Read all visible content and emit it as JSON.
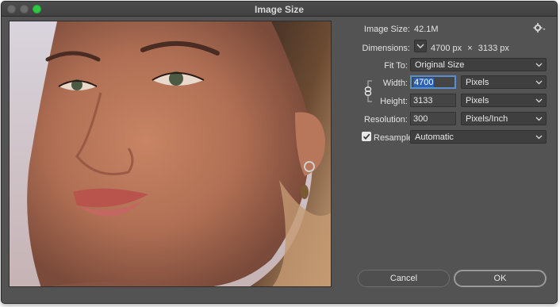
{
  "window": {
    "title": "Image Size"
  },
  "info": {
    "image_size_label": "Image Size:",
    "image_size_value": "42.1M",
    "dimensions_label": "Dimensions:",
    "dimensions_width": "4700 px",
    "dimensions_sep": "×",
    "dimensions_height": "3133 px"
  },
  "fit_to": {
    "label": "Fit To:",
    "value": "Original Size"
  },
  "width": {
    "label": "Width:",
    "value": "4700",
    "unit": "Pixels"
  },
  "height": {
    "label": "Height:",
    "value": "3133",
    "unit": "Pixels"
  },
  "resolution": {
    "label": "Resolution:",
    "value": "300",
    "unit": "Pixels/Inch"
  },
  "resample": {
    "label": "Resample:",
    "checked": true,
    "value": "Automatic"
  },
  "buttons": {
    "cancel": "Cancel",
    "ok": "OK"
  },
  "colors": {
    "accent": "#2d5fb5",
    "dialog_bg": "#535353",
    "field_bg": "#454545"
  },
  "icons": [
    "gear-icon",
    "chevron-down-icon",
    "link-chain-icon",
    "checkmark-icon"
  ]
}
